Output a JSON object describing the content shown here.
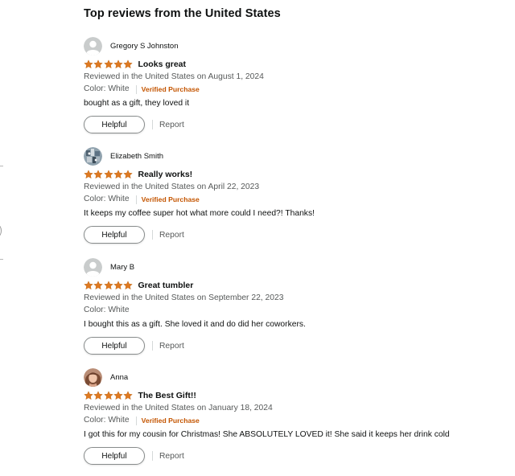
{
  "section_title": "Top reviews from the United States",
  "colors": {
    "star": "#de7921",
    "verified": "#c45500",
    "muted_text": "#565959",
    "primary_text": "#0f1111"
  },
  "icons": {
    "star": "star-filled-icon",
    "default_avatar": "default-avatar-icon"
  },
  "reviews": [
    {
      "reviewer": "Gregory S Johnston",
      "avatar": "default-avatar-icon",
      "rating": 5,
      "title": "Looks great",
      "date": "Reviewed in the United States on August 1, 2024",
      "color": "Color: White",
      "verified": "Verified Purchase",
      "body": "bought as a gift, they loved it",
      "helpful": "Helpful",
      "report": "Report"
    },
    {
      "reviewer": "Elizabeth Smith",
      "avatar": "photo-avatar",
      "rating": 5,
      "title": "Really works!",
      "date": "Reviewed in the United States on April 22, 2023",
      "color": "Color: White",
      "verified": "Verified Purchase",
      "body": "It keeps my coffee super hot what more could I need?! Thanks!",
      "helpful": "Helpful",
      "report": "Report"
    },
    {
      "reviewer": "Mary B",
      "avatar": "default-avatar-icon",
      "rating": 5,
      "title": "Great tumbler",
      "date": "Reviewed in the United States on September 22, 2023",
      "color": "Color: White",
      "body": "I bought this as a gift. She loved it and do did her coworkers.",
      "helpful": "Helpful",
      "report": "Report"
    },
    {
      "reviewer": "Anna",
      "avatar": "photo-avatar",
      "rating": 5,
      "title": "The Best Gift!!",
      "date": "Reviewed in the United States on January 18, 2024",
      "color": "Color: White",
      "verified": "Verified Purchase",
      "body": "I got this for my cousin for Christmas! She ABSOLUTELY LOVED it! She said it keeps her drink cold",
      "helpful": "Helpful",
      "report": "Report"
    }
  ]
}
